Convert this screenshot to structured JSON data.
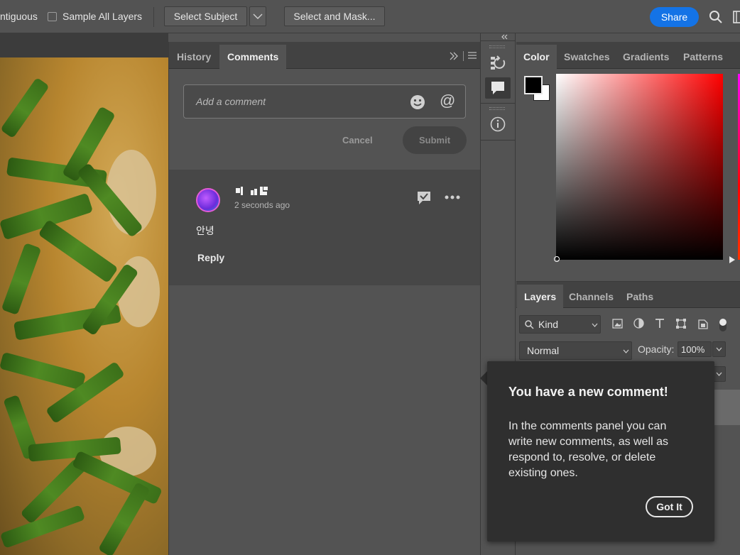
{
  "options_bar": {
    "contiguous_label": "ntiguous",
    "sample_all_layers_label": "Sample All Layers",
    "select_subject_label": "Select Subject",
    "select_and_mask_label": "Select and Mask...",
    "share_label": "Share"
  },
  "comments_panel": {
    "tabs": [
      {
        "label": "History",
        "active": false
      },
      {
        "label": "Comments",
        "active": true
      }
    ],
    "input_placeholder": "Add a comment",
    "cancel_label": "Cancel",
    "submit_label": "Submit",
    "comment": {
      "time": "2 seconds ago",
      "text": "안녕",
      "reply_label": "Reply"
    }
  },
  "color_panel": {
    "tabs": [
      {
        "label": "Color",
        "active": true
      },
      {
        "label": "Swatches",
        "active": false
      },
      {
        "label": "Gradients",
        "active": false
      },
      {
        "label": "Patterns",
        "active": false
      }
    ],
    "foreground": "#000000",
    "background": "#ffffff"
  },
  "layers_panel": {
    "tabs": [
      {
        "label": "Layers",
        "active": true
      },
      {
        "label": "Channels",
        "active": false
      },
      {
        "label": "Paths",
        "active": false
      }
    ],
    "kind_label": "Kind",
    "blend_mode": "Normal",
    "opacity_label": "Opacity:",
    "opacity_value": "100%"
  },
  "tooltip": {
    "title": "You have a new comment!",
    "body": "In the comments panel you can write new comments, as well as respond to, resolve, or delete existing ones.",
    "button_label": "Got It"
  },
  "colors": {
    "accent": "#1473e6"
  }
}
